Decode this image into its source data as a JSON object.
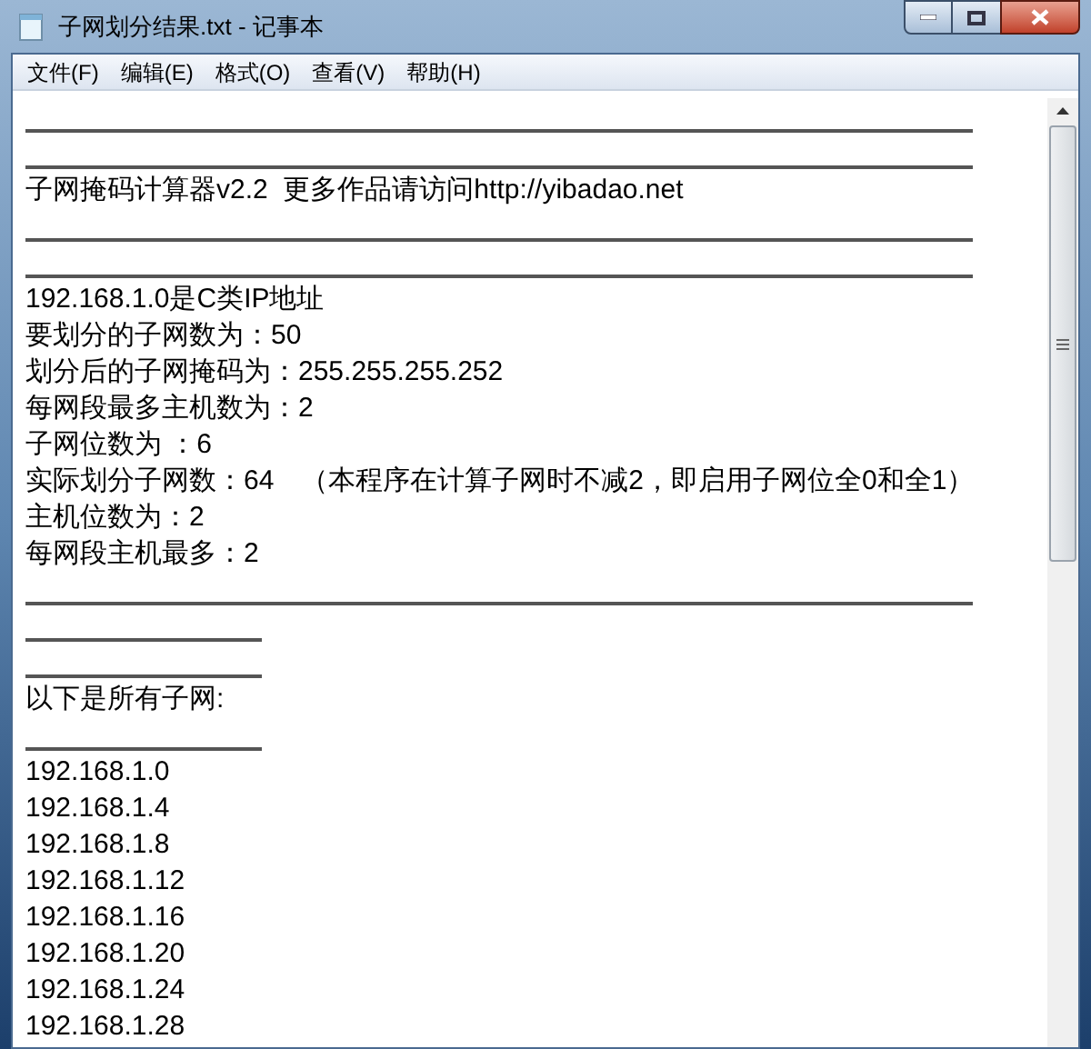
{
  "window": {
    "title": "子网划分结果.txt - 记事本"
  },
  "menu": [
    "文件(F)",
    "编辑(E)",
    "格式(O)",
    "查看(V)",
    "帮助(H)"
  ],
  "lines": [
    {
      "kind": "rule",
      "full_width": true
    },
    {
      "kind": "rule",
      "full_width": true
    },
    {
      "kind": "text",
      "text": "子网掩码计算器v2.2  更多作品请访问http://yibadao.net"
    },
    {
      "kind": "rule",
      "full_width": true
    },
    {
      "kind": "rule",
      "full_width": true
    },
    {
      "kind": "text",
      "text": "192.168.1.0是C类IP地址"
    },
    {
      "kind": "text",
      "text": "要划分的子网数为：50"
    },
    {
      "kind": "text",
      "text": "划分后的子网掩码为：255.255.255.252"
    },
    {
      "kind": "text",
      "text": "每网段最多主机数为：2"
    },
    {
      "kind": "text",
      "text": "子网位数为 ：6"
    },
    {
      "kind": "text",
      "text": "实际划分子网数：64　（本程序在计算子网时不减2，即启用子网位全0和全1）"
    },
    {
      "kind": "text",
      "text": "主机位数为：2"
    },
    {
      "kind": "text",
      "text": "每网段主机最多：2"
    },
    {
      "kind": "rule",
      "full_width": true
    },
    {
      "kind": "rule",
      "full_width": false
    },
    {
      "kind": "rule",
      "full_width": false
    },
    {
      "kind": "text",
      "text": "以下是所有子网:"
    },
    {
      "kind": "rule",
      "full_width": false
    },
    {
      "kind": "text",
      "text": "192.168.1.0"
    },
    {
      "kind": "text",
      "text": "192.168.1.4"
    },
    {
      "kind": "text",
      "text": "192.168.1.8"
    },
    {
      "kind": "text",
      "text": "192.168.1.12"
    },
    {
      "kind": "text",
      "text": "192.168.1.16"
    },
    {
      "kind": "text",
      "text": "192.168.1.20"
    },
    {
      "kind": "text",
      "text": "192.168.1.24"
    },
    {
      "kind": "text",
      "text": "192.168.1.28"
    }
  ]
}
